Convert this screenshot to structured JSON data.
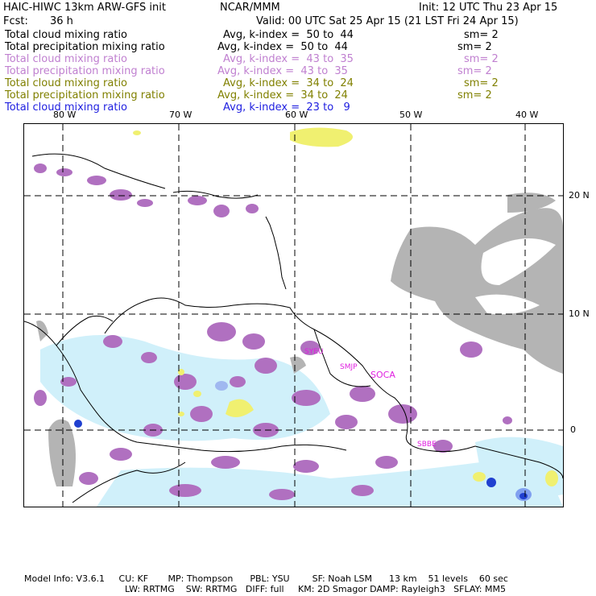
{
  "header": {
    "model_title": "HAIC-HIWC 13km ARW-GFS init",
    "org": "NCAR/MMM",
    "init": "Init: 12 UTC Thu 23 Apr 15",
    "fcst_label": "Fcst:",
    "fcst_value": "36 h",
    "valid": "Valid: 00 UTC Sat 25 Apr 15 (21 LST Fri 24 Apr 15)"
  },
  "fields": [
    {
      "name": "Total cloud mixing ratio",
      "range": "Avg, k-index =  50 to  44",
      "sm": "sm= 2",
      "color": "#000000"
    },
    {
      "name": "Total precipitation mixing ratio",
      "range": "Avg, k-index =  50 to  44",
      "sm": "sm= 2",
      "color": "#000000"
    },
    {
      "name": "Total cloud mixing ratio",
      "range": "Avg, k-index =  43 to  35",
      "sm": "sm= 2",
      "color": "#c080d0"
    },
    {
      "name": "Total precipitation mixing ratio",
      "range": "Avg, k-index =  43 to  35",
      "sm": "sm= 2",
      "color": "#c080d0"
    },
    {
      "name": "Total cloud mixing ratio",
      "range": "Avg, k-index =  34 to  24",
      "sm": "sm= 2",
      "color": "#808000"
    },
    {
      "name": "Total precipitation mixing ratio",
      "range": "Avg, k-index =  34 to  24",
      "sm": "sm= 2",
      "color": "#808000"
    },
    {
      "name": "Total cloud mixing ratio",
      "range": "Avg, k-index =  23 to   9",
      "sm": "",
      "color": "#2020e0"
    }
  ],
  "map": {
    "lon_labels": [
      "80 W",
      "70 W",
      "60 W",
      "50 W",
      "40 W"
    ],
    "lat_labels": [
      "20 N",
      "10 N",
      "0"
    ],
    "stations": [
      "SYEU",
      "SMJP",
      "SOCA",
      "SBBE"
    ],
    "colors": {
      "grey_cloud": "#b4b4b4",
      "purple_precip": "#b070c0",
      "yellow_cloud": "#f0f070",
      "light_blue_cloud": "#d0f0fa",
      "blue_core": "#2040d0",
      "station_magenta": "#e020e0"
    }
  },
  "footer": {
    "line1": "Model Info: V3.6.1     CU: KF       MP: Thompson      PBL: YSU        SF: Noah LSM      13 km    51 levels    60 sec",
    "line2": "LW: RRTMG    SW: RRTMG   DIFF: full     KM: 2D Smagor DAMP: Rayleigh3   SFLAY: MM5"
  }
}
